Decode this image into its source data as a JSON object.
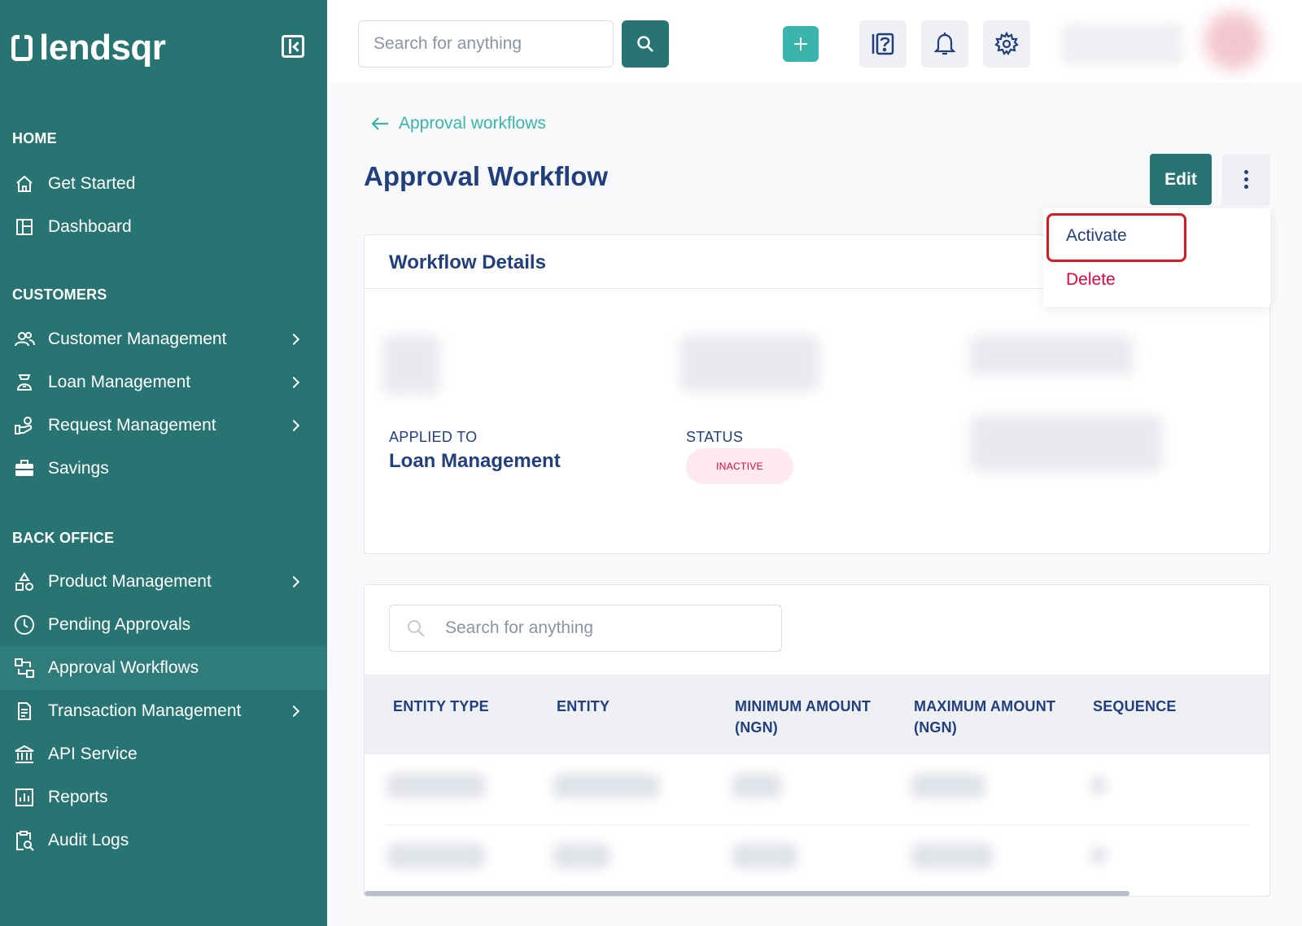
{
  "app": {
    "brand": "lendsqr"
  },
  "sidebar": {
    "sections": {
      "home": "HOME",
      "customers": "CUSTOMERS",
      "back_office": "BACK OFFICE"
    },
    "items": [
      {
        "label": "Get Started",
        "icon": "home-icon"
      },
      {
        "label": "Dashboard",
        "icon": "dashboard-icon"
      },
      {
        "label": "Customer Management",
        "icon": "users-icon"
      },
      {
        "label": "Loan Management",
        "icon": "loan-icon"
      },
      {
        "label": "Request Management",
        "icon": "request-icon"
      },
      {
        "label": "Savings",
        "icon": "briefcase-icon"
      },
      {
        "label": "Product Management",
        "icon": "shapes-icon"
      },
      {
        "label": "Pending Approvals",
        "icon": "clock-icon"
      },
      {
        "label": "Approval Workflows",
        "icon": "workflow-icon"
      },
      {
        "label": "Transaction Management",
        "icon": "transaction-icon"
      },
      {
        "label": "API Service",
        "icon": "bank-icon"
      },
      {
        "label": "Reports",
        "icon": "chart-icon"
      },
      {
        "label": "Audit Logs",
        "icon": "clipboard-search-icon"
      }
    ],
    "active_item": "Approval Workflows"
  },
  "topbar": {
    "search_placeholder": "Search for anything"
  },
  "main": {
    "back_link": "Approval workflows",
    "title": "Approval Workflow",
    "edit_label": "Edit",
    "menu": {
      "activate": "Activate",
      "delete": "Delete"
    },
    "details": {
      "header": "Workflow Details",
      "applied_to_label": "APPLIED TO",
      "applied_to_value": "Loan Management",
      "status_label": "STATUS",
      "status_value": "INACTIVE"
    },
    "table": {
      "search_placeholder": "Search for anything",
      "columns": [
        {
          "line1": "ENTITY TYPE",
          "line2": ""
        },
        {
          "line1": "ENTITY",
          "line2": ""
        },
        {
          "line1": "MINIMUM AMOUNT",
          "line2": "(NGN)"
        },
        {
          "line1": "MAXIMUM AMOUNT",
          "line2": "(NGN)"
        },
        {
          "line1": "SEQUENCE",
          "line2": ""
        }
      ]
    }
  },
  "colors": {
    "sidebar": "#277472",
    "accent": "#39b5ac",
    "primary_text": "#213f7d",
    "danger": "#e4033b",
    "highlight": "#d71920"
  }
}
